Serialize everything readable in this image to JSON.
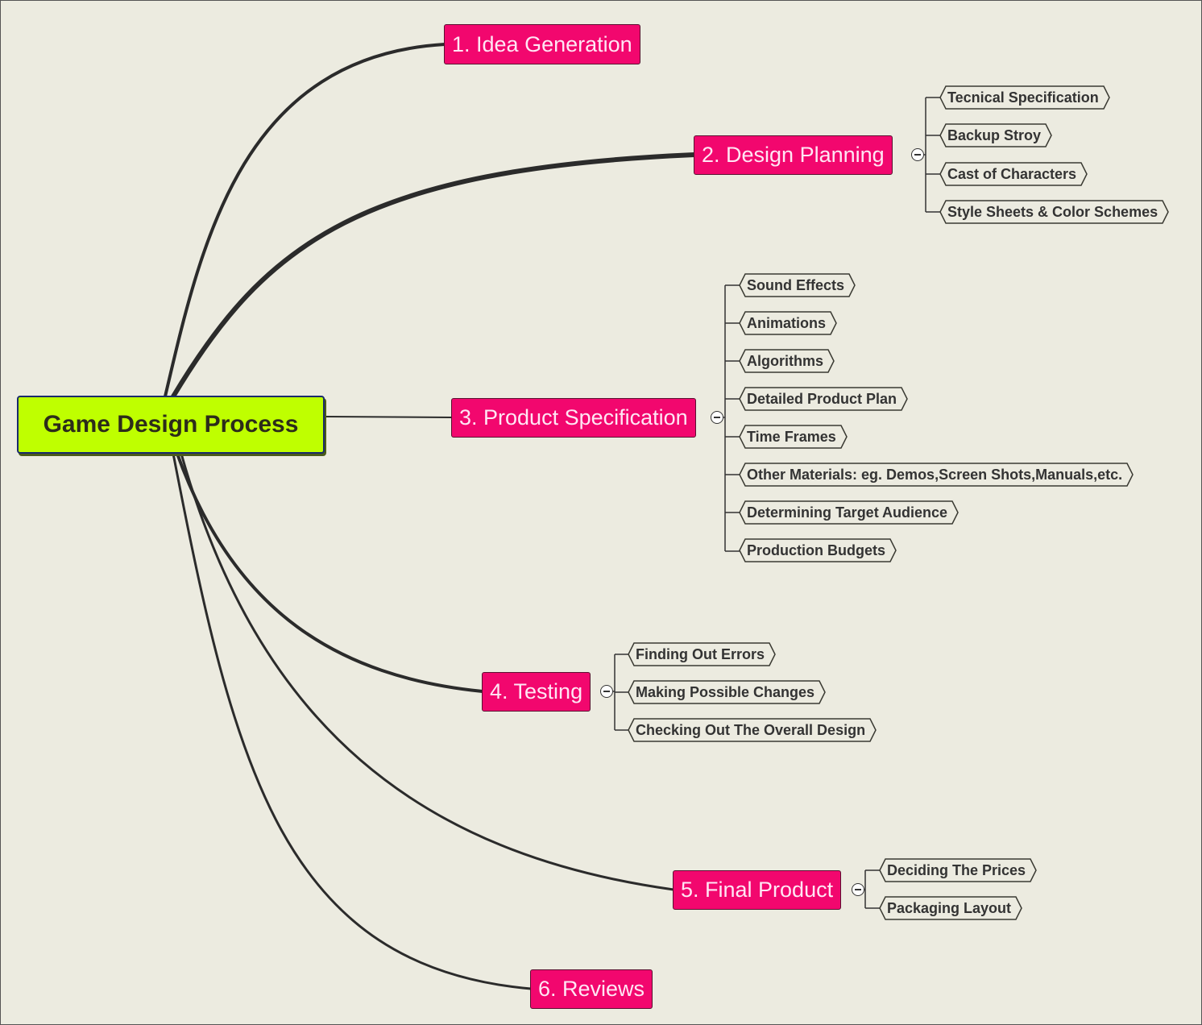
{
  "title": "Game Design Process",
  "colors": {
    "root_fill": "#bfff00",
    "branch_fill": "#f2076e",
    "branch_text": "#ffe6f4",
    "background": "#ecebe0"
  },
  "branches": [
    {
      "label": "1. Idea Generation",
      "children": []
    },
    {
      "label": "2. Design Planning",
      "children": [
        "Tecnical Specification",
        "Backup Stroy",
        "Cast of Characters",
        "Style Sheets & Color Schemes"
      ]
    },
    {
      "label": "3. Product Specification",
      "children": [
        "Sound Effects",
        "Animations",
        "Algorithms",
        "Detailed Product Plan",
        "Time Frames",
        "Other Materials: eg. Demos,Screen Shots,Manuals,etc.",
        "Determining Target Audience",
        "Production Budgets"
      ]
    },
    {
      "label": "4. Testing",
      "children": [
        "Finding Out Errors",
        "Making Possible Changes",
        "Checking Out The Overall Design"
      ]
    },
    {
      "label": "5. Final Product",
      "children": [
        "Deciding The Prices",
        "Packaging Layout"
      ]
    },
    {
      "label": "6. Reviews",
      "children": []
    }
  ]
}
